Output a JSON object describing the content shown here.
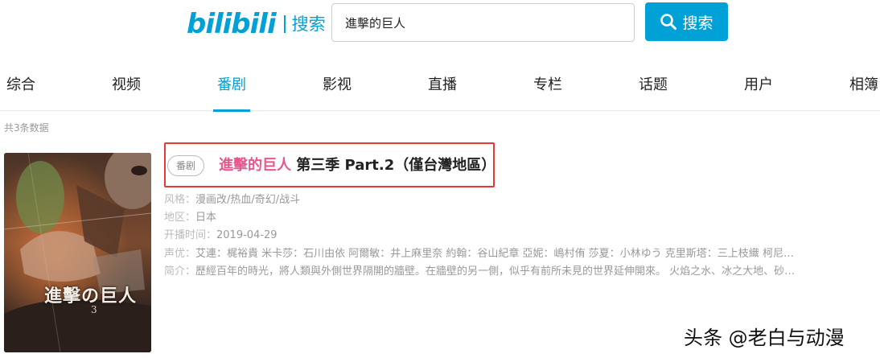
{
  "header": {
    "logo_text": "bilibili",
    "logo_search": "搜索",
    "search_value": "進擊的巨人",
    "search_button": "搜索"
  },
  "tabs": [
    {
      "label": "综合"
    },
    {
      "label": "视频"
    },
    {
      "label": "番剧"
    },
    {
      "label": "影视"
    },
    {
      "label": "直播"
    },
    {
      "label": "专栏"
    },
    {
      "label": "话题"
    },
    {
      "label": "用户"
    },
    {
      "label": "相簿"
    }
  ],
  "active_tab": "番剧",
  "result_count": "共3条数据",
  "result": {
    "type_badge": "番剧",
    "title_highlight": "進擊的巨人",
    "title_rest": " 第三季 Part.2（僅台灣地區）",
    "poster_title": "進擊の巨人",
    "poster_number": "3",
    "style_label": "风格：",
    "style_value": "漫画改/热血/奇幻/战斗",
    "region_label": "地区：",
    "region_value": "日本",
    "date_label": "开播时间：",
    "date_value": "2019-04-29",
    "cast_label": "声优：",
    "cast_value": "艾連：梶裕貴 米卡莎：石川由依 阿爾敏：井上麻里奈 約翰：谷山紀章 亞妮：嶋村侑 莎夏：小林ゆう 克里斯塔：三上枝織 柯尼…",
    "summary_label": "简介：",
    "summary_value": "歷經百年的時光，將人類與外側世界隔開的牆壁。在牆壁的另一側，似乎有前所未見的世界延伸開來。 火焰之水、冰之大地、砂…"
  },
  "watermark": "头条 @老白与动漫",
  "colors": {
    "accent": "#00a1d6",
    "highlight": "#e7568c",
    "annotation_box": "#e53935"
  }
}
